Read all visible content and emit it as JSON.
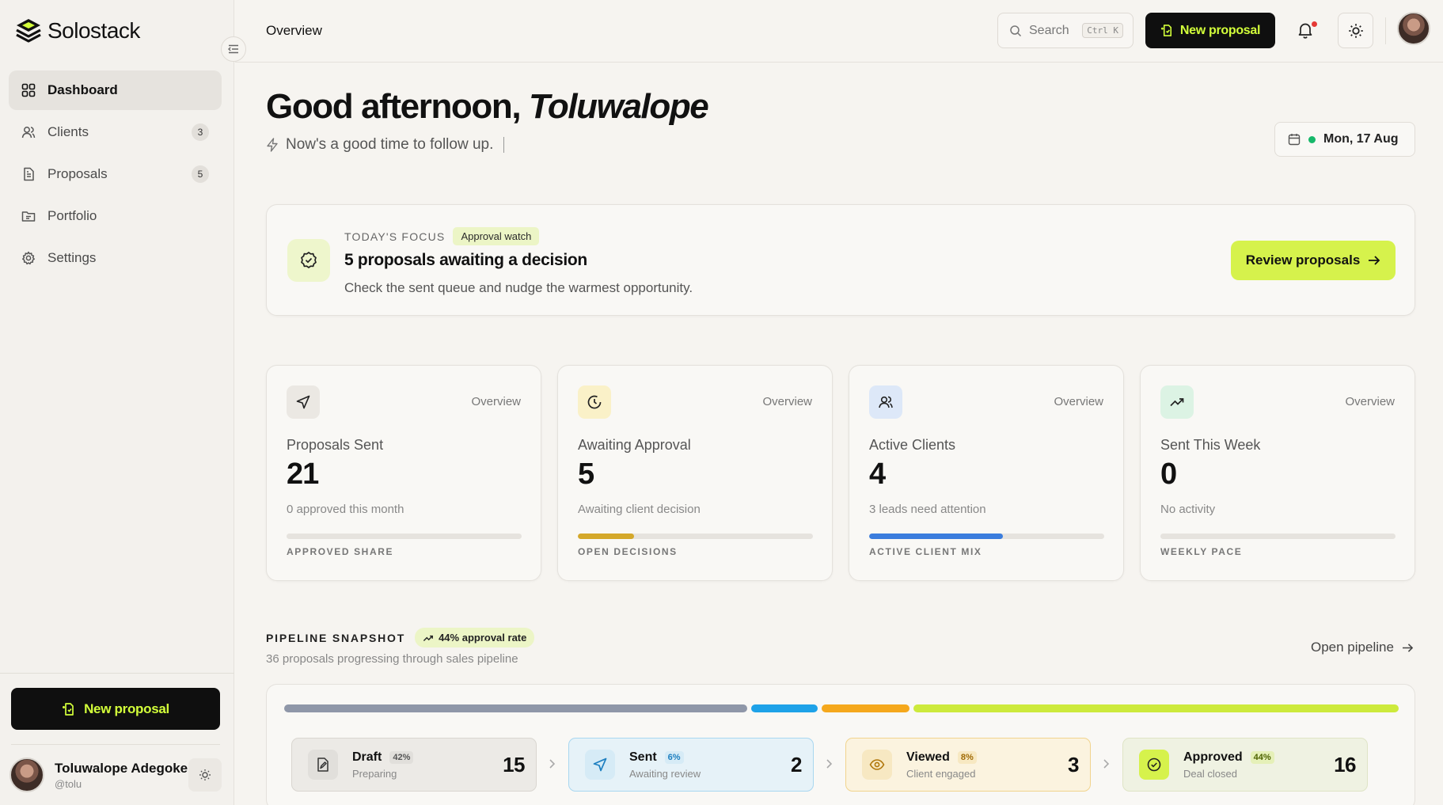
{
  "app": {
    "name": "Solostack"
  },
  "sidebar": {
    "items": [
      {
        "label": "Dashboard",
        "icon": "dashboard-icon",
        "active": true
      },
      {
        "label": "Clients",
        "icon": "users-icon",
        "badge": "3"
      },
      {
        "label": "Proposals",
        "icon": "document-icon",
        "badge": "5"
      },
      {
        "label": "Portfolio",
        "icon": "folder-icon"
      },
      {
        "label": "Settings",
        "icon": "gear-icon"
      }
    ],
    "new_proposal_label": "New proposal",
    "user": {
      "name": "Toluwalope Adegoke",
      "handle": "@tolu"
    }
  },
  "topbar": {
    "title": "Overview",
    "search_label": "Search",
    "search_shortcut": "Ctrl K",
    "new_proposal_label": "New proposal"
  },
  "greeting": {
    "prefix": "Good afternoon, ",
    "name": "Toluwalope",
    "subtitle": "Now's a good time to follow up."
  },
  "date_chip": {
    "label": "Mon, 17 Aug"
  },
  "focus": {
    "eyebrow": "TODAY'S FOCUS",
    "tag": "Approval watch",
    "title": "5 proposals awaiting a decision",
    "description": "Check the sent queue and nudge the warmest opportunity.",
    "button_label": "Review proposals"
  },
  "stats": [
    {
      "tag": "Overview",
      "label": "Proposals Sent",
      "value": "21",
      "sub": "0 approved this month",
      "footer": "APPROVED SHARE",
      "progress": 0,
      "color": "#d0cdc7",
      "icon": "send-icon",
      "icon_bg": "#ebe8e3"
    },
    {
      "tag": "Overview",
      "label": "Awaiting Approval",
      "value": "5",
      "sub": "Awaiting client decision",
      "footer": "OPEN DECISIONS",
      "progress": 0.24,
      "color": "#d4a82a",
      "icon": "clock-icon",
      "icon_bg": "#faf1c8"
    },
    {
      "tag": "Overview",
      "label": "Active Clients",
      "value": "4",
      "sub": "3 leads need attention",
      "footer": "ACTIVE CLIENT MIX",
      "progress": 0.57,
      "color": "#3b7ddd",
      "icon": "users-icon",
      "icon_bg": "#dde8f8"
    },
    {
      "tag": "Overview",
      "label": "Sent This Week",
      "value": "0",
      "sub": "No activity",
      "footer": "WEEKLY PACE",
      "progress": 0,
      "color": "#d0cdc7",
      "icon": "trending-up-icon",
      "icon_bg": "#dcf3e4"
    }
  ],
  "pipeline": {
    "title": "PIPELINE SNAPSHOT",
    "badge": "44% approval rate",
    "subtitle": "36 proposals progressing through sales pipeline",
    "link_label": "Open pipeline",
    "stages": [
      {
        "name": "Draft",
        "pct": "42%",
        "desc": "Preparing",
        "count": "15",
        "share": 0.42,
        "color": "#8f97a8",
        "icon": "file-edit-icon"
      },
      {
        "name": "Sent",
        "pct": "6%",
        "desc": "Awaiting review",
        "count": "2",
        "share": 0.06,
        "color": "#1ea2e8",
        "icon": "send-icon"
      },
      {
        "name": "Viewed",
        "pct": "8%",
        "desc": "Client engaged",
        "count": "3",
        "share": 0.08,
        "color": "#f5a81c",
        "icon": "eye-icon"
      },
      {
        "name": "Approved",
        "pct": "44%",
        "desc": "Deal closed",
        "count": "16",
        "share": 0.44,
        "color": "#cdea3c",
        "icon": "check-circle-icon"
      }
    ]
  }
}
